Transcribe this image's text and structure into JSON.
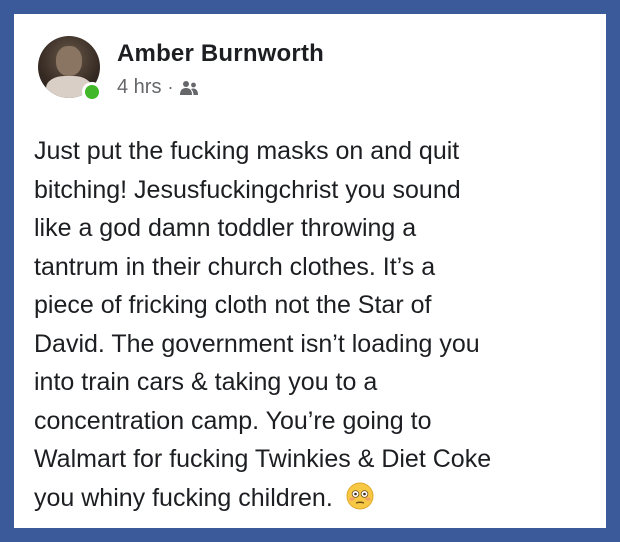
{
  "post": {
    "author": "Amber Burnworth",
    "time": "4 hrs",
    "separator": "·",
    "audience_icon": "friends-icon",
    "online_status": "online",
    "text_lines": [
      "Just put the fucking masks on and quit",
      "bitching! Jesusfuckingchrist you sound",
      "like a god damn toddler throwing a",
      "tantrum in their church clothes. It’s a",
      "piece of fricking cloth not the Star of",
      "David. The government isn’t loading you",
      "into train cars & taking you to a",
      "concentration camp. You’re going to",
      "Walmart for fucking Twinkies & Diet Coke",
      "you whiny fucking children."
    ],
    "emoji": "flushed-face-emoji"
  },
  "colors": {
    "frame": "#3b5a9a",
    "online": "#42b72a",
    "meta": "#65676b",
    "text": "#1c1e21"
  }
}
